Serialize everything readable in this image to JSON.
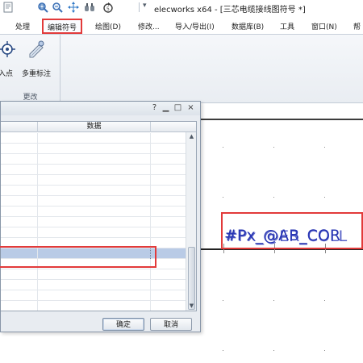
{
  "window": {
    "title": "elecworks x64 - [三芯电缆接线图符号 *]"
  },
  "quick_access": {
    "icons": [
      "document-icon",
      "zoom-window-icon",
      "zoom-out-icon",
      "pan-icon",
      "binoculars-icon",
      "refresh-icon"
    ],
    "dropdown": "▾"
  },
  "tabs": [
    {
      "label": "处理",
      "active": false
    },
    {
      "label": "编辑符号",
      "active": true
    },
    {
      "label": "绘图(D)",
      "active": false
    },
    {
      "label": "修改...",
      "active": false
    },
    {
      "label": "导入/导出(I)",
      "active": false
    },
    {
      "label": "数据库(B)",
      "active": false
    },
    {
      "label": "工具",
      "active": false
    },
    {
      "label": "窗口(N)",
      "active": false
    },
    {
      "label": "帮",
      "active": false
    }
  ],
  "ribbon": {
    "group_label": "更改",
    "buttons": [
      {
        "label": "插入点",
        "visible_label": "插入点",
        "icon": "insert-point-icon"
      },
      {
        "label": "多重标注",
        "icon": "multi-label-icon"
      }
    ]
  },
  "dialog": {
    "controls": {
      "help": "?",
      "minimize": "▁",
      "maximize": "□",
      "close": "×"
    },
    "grid": {
      "columns": [
        "",
        "数据"
      ],
      "rows": 27,
      "selected_row_index": 11
    },
    "buttons": {
      "ok": "确定",
      "cancel": "取消"
    }
  },
  "drawing": {
    "symbol_text": "#Px_@AB_COR",
    "symbol_text_overlay": "#Px_@ER_COLL"
  },
  "colors": {
    "highlight": "#e23a3a",
    "selection": "#b9cbe6",
    "symbol_text": "#2533b0"
  }
}
